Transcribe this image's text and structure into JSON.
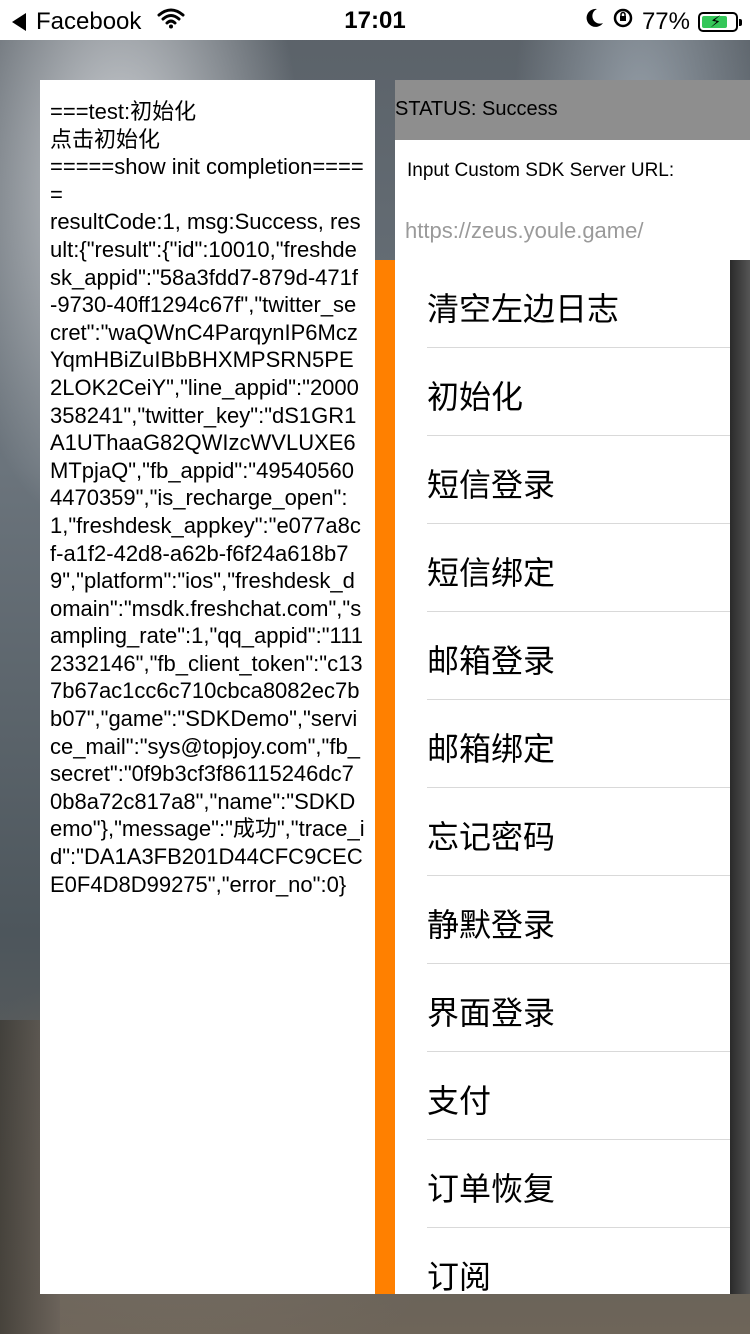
{
  "status_bar": {
    "back_app": "Facebook",
    "time": "17:01",
    "battery": "77%",
    "battery_level": 0.77
  },
  "log": {
    "text": "===test:初始化\n点击初始化\n=====show init completion=====\nresultCode:1, msg:Success, result:{\"result\":{\"id\":10010,\"freshdesk_appid\":\"58a3fdd7-879d-471f-9730-40ff1294c67f\",\"twitter_secret\":\"waQWnC4ParqynIP6MczYqmHBiZuIBbBHXMPSRN5PE2LOK2CeiY\",\"line_appid\":\"2000358241\",\"twitter_key\":\"dS1GR1A1UThaaG82QWIzcWVLUXE6MTpjaQ\",\"fb_appid\":\"495405604470359\",\"is_recharge_open\":1,\"freshdesk_appkey\":\"e077a8cf-a1f2-42d8-a62b-f6f24a618b79\",\"platform\":\"ios\",\"freshdesk_domain\":\"msdk.freshchat.com\",\"sampling_rate\":1,\"qq_appid\":\"1112332146\",\"fb_client_token\":\"c137b67ac1cc6c710cbca8082ec7bb07\",\"game\":\"SDKDemo\",\"service_mail\":\"sys@topjoy.com\",\"fb_secret\":\"0f9b3cf3f86115246dc70b8a72c817a8\",\"name\":\"SDKDemo\"},\"message\":\"成功\",\"trace_id\":\"DA1A3FB201D44CFC9CECE0F4D8D99275\",\"error_no\":0}"
  },
  "status_header": {
    "text": "STATUS: Success"
  },
  "server_url": {
    "label": "Input Custom SDK Server URL:",
    "placeholder": "https://zeus.youle.game/"
  },
  "menu": {
    "items": [
      {
        "label": "清空左边日志"
      },
      {
        "label": "初始化"
      },
      {
        "label": "短信登录"
      },
      {
        "label": "短信绑定"
      },
      {
        "label": "邮箱登录"
      },
      {
        "label": "邮箱绑定"
      },
      {
        "label": "忘记密码"
      },
      {
        "label": "静默登录"
      },
      {
        "label": "界面登录"
      },
      {
        "label": "支付"
      },
      {
        "label": "订单恢复"
      },
      {
        "label": "订阅"
      }
    ]
  }
}
